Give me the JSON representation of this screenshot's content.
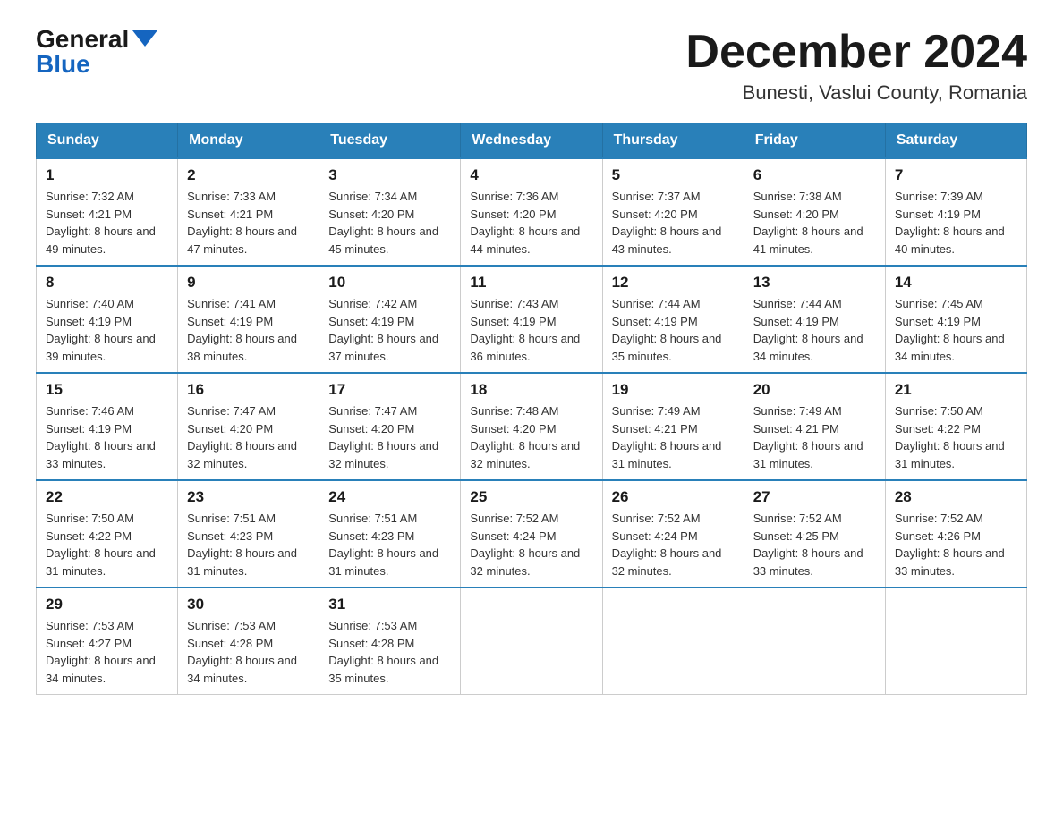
{
  "logo": {
    "general": "General",
    "blue": "Blue"
  },
  "title": {
    "month_year": "December 2024",
    "location": "Bunesti, Vaslui County, Romania"
  },
  "headers": [
    "Sunday",
    "Monday",
    "Tuesday",
    "Wednesday",
    "Thursday",
    "Friday",
    "Saturday"
  ],
  "weeks": [
    [
      {
        "day": "1",
        "sunrise": "7:32 AM",
        "sunset": "4:21 PM",
        "daylight": "8 hours and 49 minutes."
      },
      {
        "day": "2",
        "sunrise": "7:33 AM",
        "sunset": "4:21 PM",
        "daylight": "8 hours and 47 minutes."
      },
      {
        "day": "3",
        "sunrise": "7:34 AM",
        "sunset": "4:20 PM",
        "daylight": "8 hours and 45 minutes."
      },
      {
        "day": "4",
        "sunrise": "7:36 AM",
        "sunset": "4:20 PM",
        "daylight": "8 hours and 44 minutes."
      },
      {
        "day": "5",
        "sunrise": "7:37 AM",
        "sunset": "4:20 PM",
        "daylight": "8 hours and 43 minutes."
      },
      {
        "day": "6",
        "sunrise": "7:38 AM",
        "sunset": "4:20 PM",
        "daylight": "8 hours and 41 minutes."
      },
      {
        "day": "7",
        "sunrise": "7:39 AM",
        "sunset": "4:19 PM",
        "daylight": "8 hours and 40 minutes."
      }
    ],
    [
      {
        "day": "8",
        "sunrise": "7:40 AM",
        "sunset": "4:19 PM",
        "daylight": "8 hours and 39 minutes."
      },
      {
        "day": "9",
        "sunrise": "7:41 AM",
        "sunset": "4:19 PM",
        "daylight": "8 hours and 38 minutes."
      },
      {
        "day": "10",
        "sunrise": "7:42 AM",
        "sunset": "4:19 PM",
        "daylight": "8 hours and 37 minutes."
      },
      {
        "day": "11",
        "sunrise": "7:43 AM",
        "sunset": "4:19 PM",
        "daylight": "8 hours and 36 minutes."
      },
      {
        "day": "12",
        "sunrise": "7:44 AM",
        "sunset": "4:19 PM",
        "daylight": "8 hours and 35 minutes."
      },
      {
        "day": "13",
        "sunrise": "7:44 AM",
        "sunset": "4:19 PM",
        "daylight": "8 hours and 34 minutes."
      },
      {
        "day": "14",
        "sunrise": "7:45 AM",
        "sunset": "4:19 PM",
        "daylight": "8 hours and 34 minutes."
      }
    ],
    [
      {
        "day": "15",
        "sunrise": "7:46 AM",
        "sunset": "4:19 PM",
        "daylight": "8 hours and 33 minutes."
      },
      {
        "day": "16",
        "sunrise": "7:47 AM",
        "sunset": "4:20 PM",
        "daylight": "8 hours and 32 minutes."
      },
      {
        "day": "17",
        "sunrise": "7:47 AM",
        "sunset": "4:20 PM",
        "daylight": "8 hours and 32 minutes."
      },
      {
        "day": "18",
        "sunrise": "7:48 AM",
        "sunset": "4:20 PM",
        "daylight": "8 hours and 32 minutes."
      },
      {
        "day": "19",
        "sunrise": "7:49 AM",
        "sunset": "4:21 PM",
        "daylight": "8 hours and 31 minutes."
      },
      {
        "day": "20",
        "sunrise": "7:49 AM",
        "sunset": "4:21 PM",
        "daylight": "8 hours and 31 minutes."
      },
      {
        "day": "21",
        "sunrise": "7:50 AM",
        "sunset": "4:22 PM",
        "daylight": "8 hours and 31 minutes."
      }
    ],
    [
      {
        "day": "22",
        "sunrise": "7:50 AM",
        "sunset": "4:22 PM",
        "daylight": "8 hours and 31 minutes."
      },
      {
        "day": "23",
        "sunrise": "7:51 AM",
        "sunset": "4:23 PM",
        "daylight": "8 hours and 31 minutes."
      },
      {
        "day": "24",
        "sunrise": "7:51 AM",
        "sunset": "4:23 PM",
        "daylight": "8 hours and 31 minutes."
      },
      {
        "day": "25",
        "sunrise": "7:52 AM",
        "sunset": "4:24 PM",
        "daylight": "8 hours and 32 minutes."
      },
      {
        "day": "26",
        "sunrise": "7:52 AM",
        "sunset": "4:24 PM",
        "daylight": "8 hours and 32 minutes."
      },
      {
        "day": "27",
        "sunrise": "7:52 AM",
        "sunset": "4:25 PM",
        "daylight": "8 hours and 33 minutes."
      },
      {
        "day": "28",
        "sunrise": "7:52 AM",
        "sunset": "4:26 PM",
        "daylight": "8 hours and 33 minutes."
      }
    ],
    [
      {
        "day": "29",
        "sunrise": "7:53 AM",
        "sunset": "4:27 PM",
        "daylight": "8 hours and 34 minutes."
      },
      {
        "day": "30",
        "sunrise": "7:53 AM",
        "sunset": "4:28 PM",
        "daylight": "8 hours and 34 minutes."
      },
      {
        "day": "31",
        "sunrise": "7:53 AM",
        "sunset": "4:28 PM",
        "daylight": "8 hours and 35 minutes."
      },
      null,
      null,
      null,
      null
    ]
  ]
}
